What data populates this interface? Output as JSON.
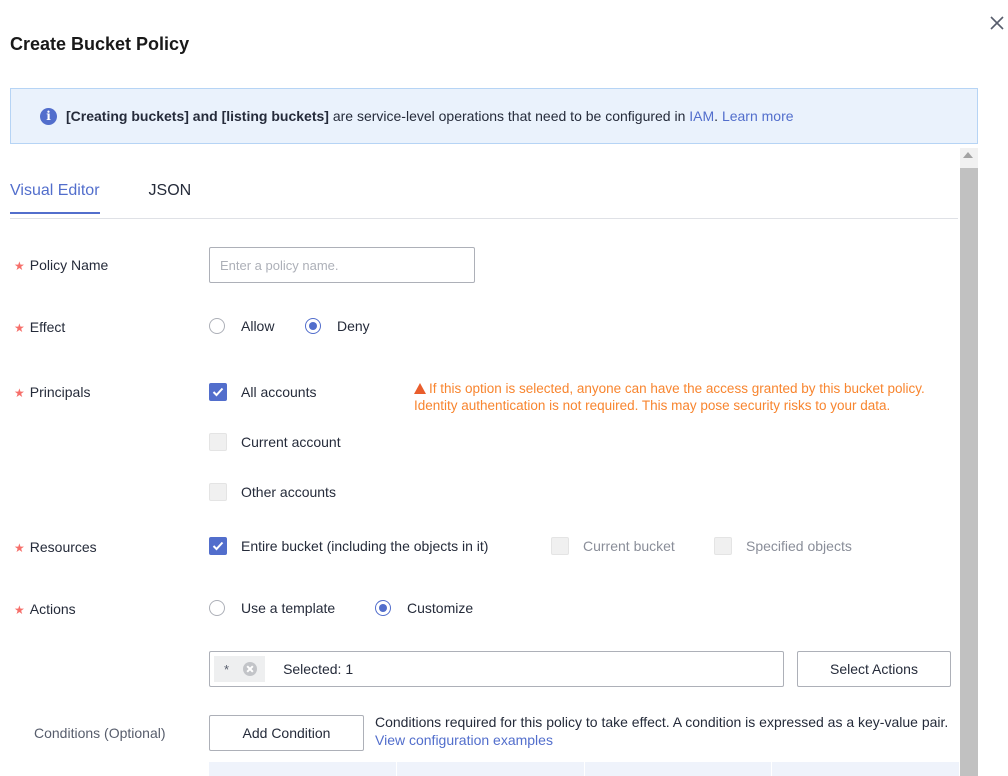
{
  "dialog": {
    "title": "Create Bucket Policy"
  },
  "banner": {
    "bold_text": "[Creating buckets] and [listing buckets]",
    "text": " are service-level operations that need to be configured in ",
    "iam_link": "IAM",
    "learn_more": "Learn more",
    "icon": "info-icon"
  },
  "tabs": [
    {
      "label": "Visual Editor",
      "active": true
    },
    {
      "label": "JSON",
      "active": false
    }
  ],
  "form": {
    "policy_name": {
      "label": "Policy Name",
      "placeholder": "Enter a policy name.",
      "value": ""
    },
    "effect": {
      "label": "Effect",
      "options": [
        "Allow",
        "Deny"
      ],
      "selected": "Deny"
    },
    "principals": {
      "label": "Principals",
      "options": [
        {
          "label": "All accounts",
          "checked": true
        },
        {
          "label": "Current account",
          "checked": false
        },
        {
          "label": "Other accounts",
          "checked": false
        }
      ],
      "warning": "If this option is selected, anyone can have the access granted by this bucket policy. Identity authentication is not required. This may pose security risks to your data."
    },
    "resources": {
      "label": "Resources",
      "options": [
        {
          "label": "Entire bucket (including the objects in it)",
          "checked": true,
          "disabled": false
        },
        {
          "label": "Current bucket",
          "checked": false,
          "disabled": true
        },
        {
          "label": "Specified objects",
          "checked": false,
          "disabled": true
        }
      ]
    },
    "actions": {
      "label": "Actions",
      "options": [
        "Use a template",
        "Customize"
      ],
      "selected": "Customize",
      "tag": "*",
      "selected_count": "Selected: 1",
      "select_button": "Select Actions"
    },
    "conditions": {
      "label": "Conditions (Optional)",
      "add_button": "Add Condition",
      "description": "Conditions required for this policy to take effect. A condition is expressed as a key-value pair. ",
      "examples_link": "View configuration examples"
    }
  },
  "colors": {
    "accent": "#526ecc",
    "warning": "#f8852f",
    "required": "#f66f6a",
    "banner_bg": "#eaf2fc"
  }
}
